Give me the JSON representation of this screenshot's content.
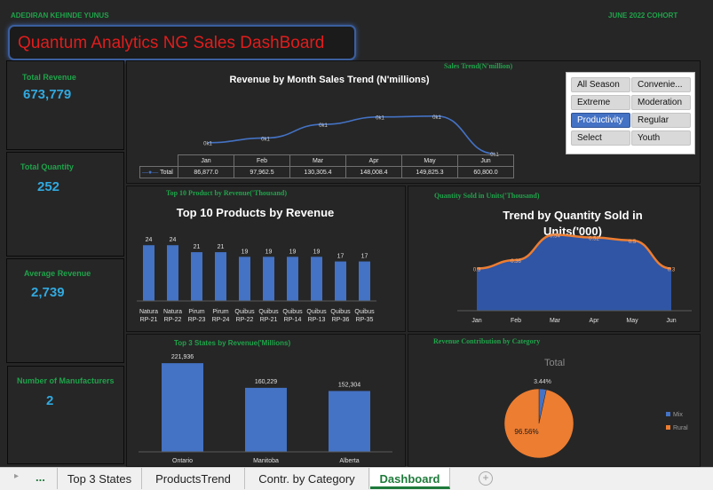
{
  "header": {
    "author": "ADEDIRAN KEHINDE YUNUS",
    "cohort": "JUNE 2022 COHORT",
    "dashboard_title": "Quantum Analytics NG Sales DashBoard"
  },
  "kpis": {
    "revenue_label": "Total Revenue",
    "revenue_value": "673,779",
    "quantity_label": "Total Quantity",
    "quantity_value": "252",
    "avg_label": "Average Revenue",
    "avg_value": "2,739",
    "manufacturers_label": "Number of Manufacturers",
    "manufacturers_value": "2"
  },
  "slicer": {
    "items": [
      "All Season",
      "Convenie...",
      "Extreme",
      "Moderation",
      "Productivity",
      "Regular",
      "Select",
      "Youth"
    ],
    "selected": "Productivity"
  },
  "sales_trend": {
    "section_label": "Sales Trend(N'million)",
    "title": "Revenue by Month Sales Trend (N'millions)",
    "legend": "Total",
    "point_label": "0k1",
    "months": [
      "Jan",
      "Feb",
      "Mar",
      "Apr",
      "May",
      "Jun"
    ],
    "values": [
      "86,877.0",
      "97,962.5",
      "130,305.4",
      "148,008.4",
      "149,825.3",
      "60,800.0"
    ],
    "line_color": "#4472c4"
  },
  "top_products": {
    "section_label": "Top 10 Product by Revenue('Thousand)",
    "title": "Top 10 Products by Revenue",
    "bar_color": "#4472c4"
  },
  "quantity_trend": {
    "section_label": "Quantity Sold in Units('Thousand)",
    "title": "Trend by Quantity Sold in Units('000)",
    "line_color": "#ed7d31"
  },
  "top_states": {
    "section_label": "Top 3 States by Revenue('Millions)",
    "bar_color": "#4472c4"
  },
  "category": {
    "section_label": "Revenue Contribution by Category",
    "title": "Total",
    "slices": [
      {
        "name": "Mix",
        "label": "3.44%",
        "color": "#4472c4"
      },
      {
        "name": "Rural",
        "label": "96.56%",
        "color": "#ed7d31"
      }
    ]
  },
  "tabs": {
    "ellipsis": "...",
    "items": [
      "Top 3 States",
      "ProductsTrend",
      "Contr. by Category",
      "Dashboard"
    ],
    "active": "Dashboard"
  },
  "chart_data": [
    {
      "type": "line",
      "title": "Revenue by Month Sales Trend (N'millions)",
      "categories": [
        "Jan",
        "Feb",
        "Mar",
        "Apr",
        "May",
        "Jun"
      ],
      "series": [
        {
          "name": "Total",
          "values": [
            86877.0,
            97962.5,
            130305.4,
            148008.4,
            149825.3,
            60800.0
          ]
        }
      ],
      "point_labels": [
        "0k1",
        "0k1",
        "0k1",
        "0k1",
        "0k1",
        "0k1"
      ]
    },
    {
      "type": "bar",
      "title": "Top 10 Products by Revenue",
      "categories": [
        [
          "Natura",
          "RP-21"
        ],
        [
          "Natura",
          "RP-22"
        ],
        [
          "Pirum",
          "RP-23"
        ],
        [
          "Pirum",
          "RP-24"
        ],
        [
          "Quibus",
          "RP-22"
        ],
        [
          "Quibus",
          "RP-21"
        ],
        [
          "Quibus",
          "RP-14"
        ],
        [
          "Quibus",
          "RP-13"
        ],
        [
          "Quibus",
          "RP-36"
        ],
        [
          "Quibus",
          "RP-35"
        ]
      ],
      "values": [
        24,
        24,
        21,
        21,
        19,
        19,
        19,
        19,
        17,
        17
      ],
      "ylim": [
        0,
        26
      ]
    },
    {
      "type": "area",
      "title": "Trend by Quantity Sold in Units('000)",
      "categories": [
        "Jan",
        "Feb",
        "Mar",
        "Apr",
        "May",
        "Jun"
      ],
      "values": [
        0.3,
        0.36,
        0.54,
        0.52,
        0.5,
        0.3
      ],
      "point_labels": [
        "0.3",
        "0.36",
        "0.54",
        "0.52",
        "0.5",
        "0.3"
      ],
      "ylim": [
        0,
        0.6
      ]
    },
    {
      "type": "bar",
      "title": "",
      "categories": [
        "Ontario",
        "Manitoba",
        "Alberta"
      ],
      "values": [
        221936,
        160229,
        152304
      ],
      "data_labels": [
        "221,936",
        "160,229",
        "152,304"
      ],
      "ylim": [
        0,
        240000
      ]
    },
    {
      "type": "pie",
      "title": "Total",
      "categories": [
        "Mix",
        "Rural"
      ],
      "values": [
        3.44,
        96.56
      ],
      "data_labels": [
        "3.44%",
        "96.56%"
      ],
      "legend": "right"
    }
  ]
}
